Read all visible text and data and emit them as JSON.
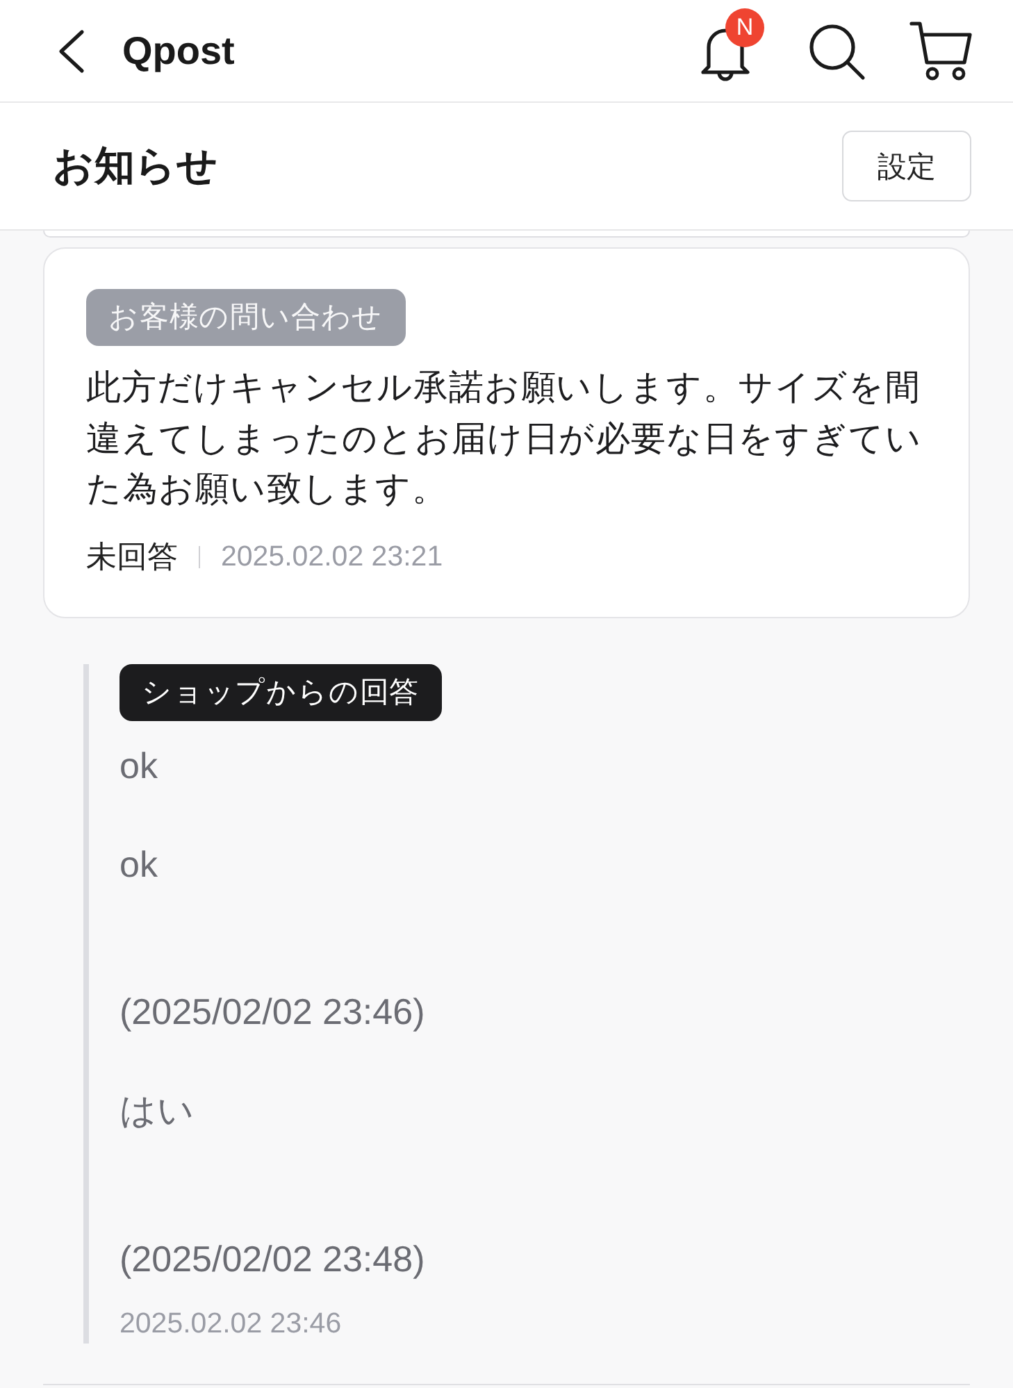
{
  "header": {
    "title": "Qpost",
    "notification_badge": "N"
  },
  "page": {
    "title": "お知らせ",
    "settings_button": "設定"
  },
  "inquiry": {
    "tag": "お客様の問い合わせ",
    "message": "此方だけキャンセル承諾お願いします。サイズを間違えてしまったのとお届け日が必要な日をすぎていた為お願い致します。",
    "status": "未回答",
    "date": "2025.02.02 23:21"
  },
  "reply": {
    "tag": "ショップからの回答",
    "message": "ok\n\nok\n\n\n(2025/02/02 23:46)\n\nはい\n\n\n(2025/02/02 23:48)",
    "date": "2025.02.02 23:46"
  }
}
